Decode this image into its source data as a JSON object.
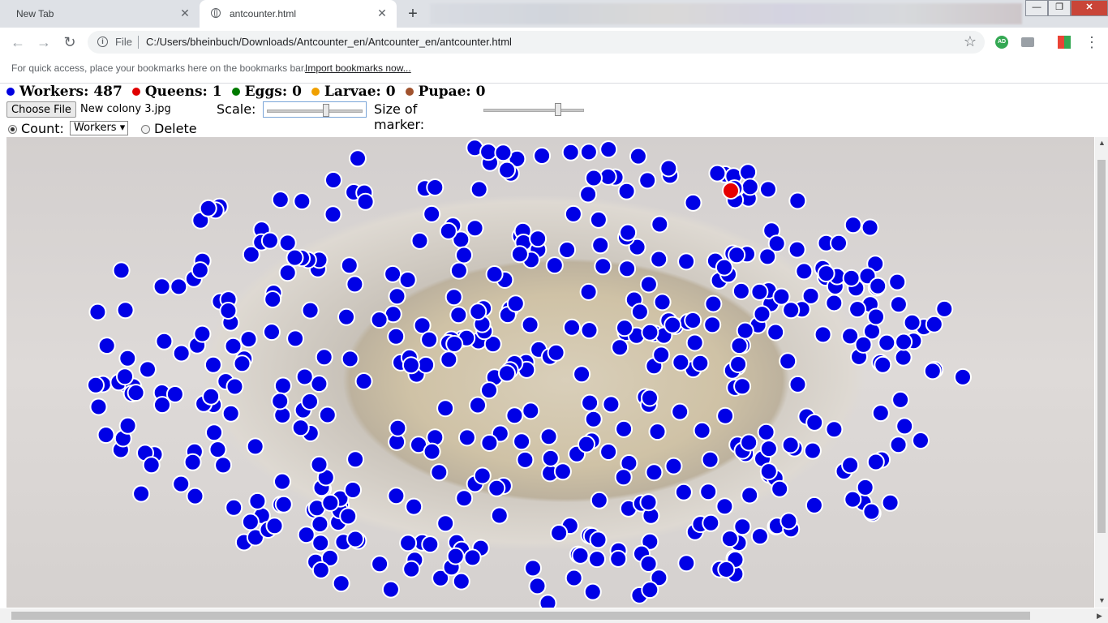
{
  "tabs": [
    {
      "label": "New Tab",
      "active": false
    },
    {
      "label": "antcounter.html",
      "active": true
    }
  ],
  "window_controls": {
    "minimize": "—",
    "maximize": "❐",
    "close": "✕"
  },
  "address_bar": {
    "scheme_label": "File",
    "url": "C:/Users/bheinbuch/Downloads/Antcounter_en/Antcounter_en/antcounter.html"
  },
  "extensions": {
    "ad_badge": "AD"
  },
  "bookmarks_bar": {
    "hint": "For quick access, place your bookmarks here on the bookmarks bar.",
    "import_link": "Import bookmarks now..."
  },
  "counters": [
    {
      "label": "Workers: 487",
      "color": "#0000e0"
    },
    {
      "label": "Queens: 1",
      "color": "#e00000"
    },
    {
      "label": "Eggs: 0",
      "color": "#007a00"
    },
    {
      "label": "Larvae: 0",
      "color": "#f0a000"
    },
    {
      "label": "Pupae: 0",
      "color": "#a0522d"
    }
  ],
  "controls": {
    "choose_file": "Choose File",
    "file_name": "New colony 3.jpg",
    "scale_label": "Scale:",
    "scale_value": 0.62,
    "marker_label": "Size of marker:",
    "marker_value": 0.76,
    "count_label": "Count:",
    "count_selected": "Workers",
    "count_mode_selected": true,
    "delete_label": "Delete"
  },
  "canvas": {
    "image": "ant colony photo with counted markers",
    "worker_marker_color": "#0000e6",
    "queen_marker_color": "#e60000",
    "worker_markers_shown": 487,
    "queen_markers_shown": 1
  }
}
